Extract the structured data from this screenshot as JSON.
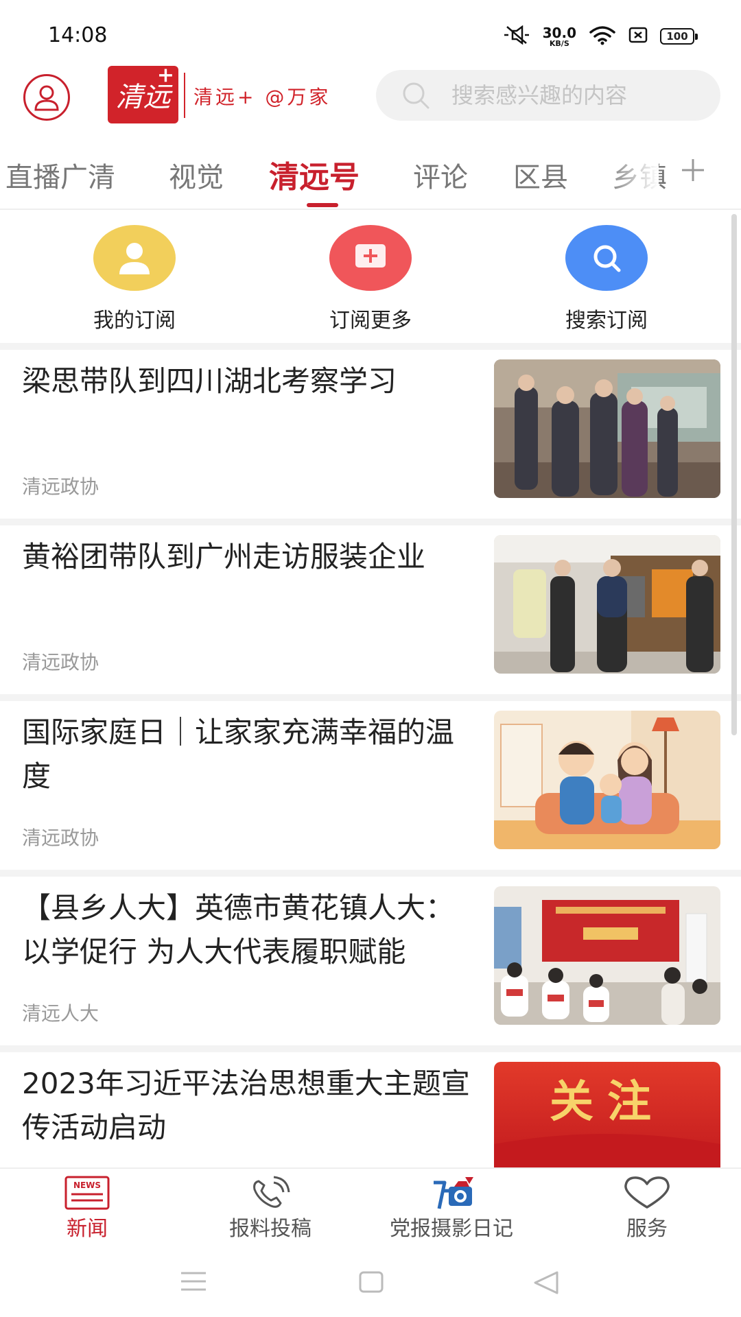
{
  "status_bar": {
    "time": "14:08",
    "net_speed_value": "30.0",
    "net_speed_unit": "KB/S",
    "battery": "100"
  },
  "header": {
    "logo_text": "清远",
    "logo_plus": "+",
    "brand_text": "清远+ @万家",
    "search_placeholder": "搜索感兴趣的内容"
  },
  "tabs": [
    {
      "label": "直播广清"
    },
    {
      "label": "视觉"
    },
    {
      "label": "清远号",
      "active": true
    },
    {
      "label": "评论"
    },
    {
      "label": "区县"
    },
    {
      "label": "乡镇"
    }
  ],
  "quick_actions": [
    {
      "label": "我的订阅",
      "color": "#f2cf5b"
    },
    {
      "label": "订阅更多",
      "color": "#f0565a"
    },
    {
      "label": "搜索订阅",
      "color": "#4d8ef6"
    }
  ],
  "news": [
    {
      "title": "梁思带队到四川湖北考察学习",
      "source": "清远政协"
    },
    {
      "title": "黄裕团带队到广州走访服装企业",
      "source": "清远政协"
    },
    {
      "title": "国际家庭日｜让家家充满幸福的温度",
      "source": "清远政协"
    },
    {
      "title": "【县乡人大】英德市黄花镇人大：以学促行 为人大代表履职赋能",
      "source": "清远人大"
    },
    {
      "title": "2023年习近平法治思想重大主题宣传活动启动",
      "source": ""
    }
  ],
  "thumb_text": {
    "banner": "关注"
  },
  "bottom_nav": [
    {
      "label": "新闻",
      "active": true
    },
    {
      "label": "报料投稿"
    },
    {
      "label": "党报摄影日记"
    },
    {
      "label": "服务"
    }
  ],
  "colors": {
    "accent": "#c8202d"
  }
}
